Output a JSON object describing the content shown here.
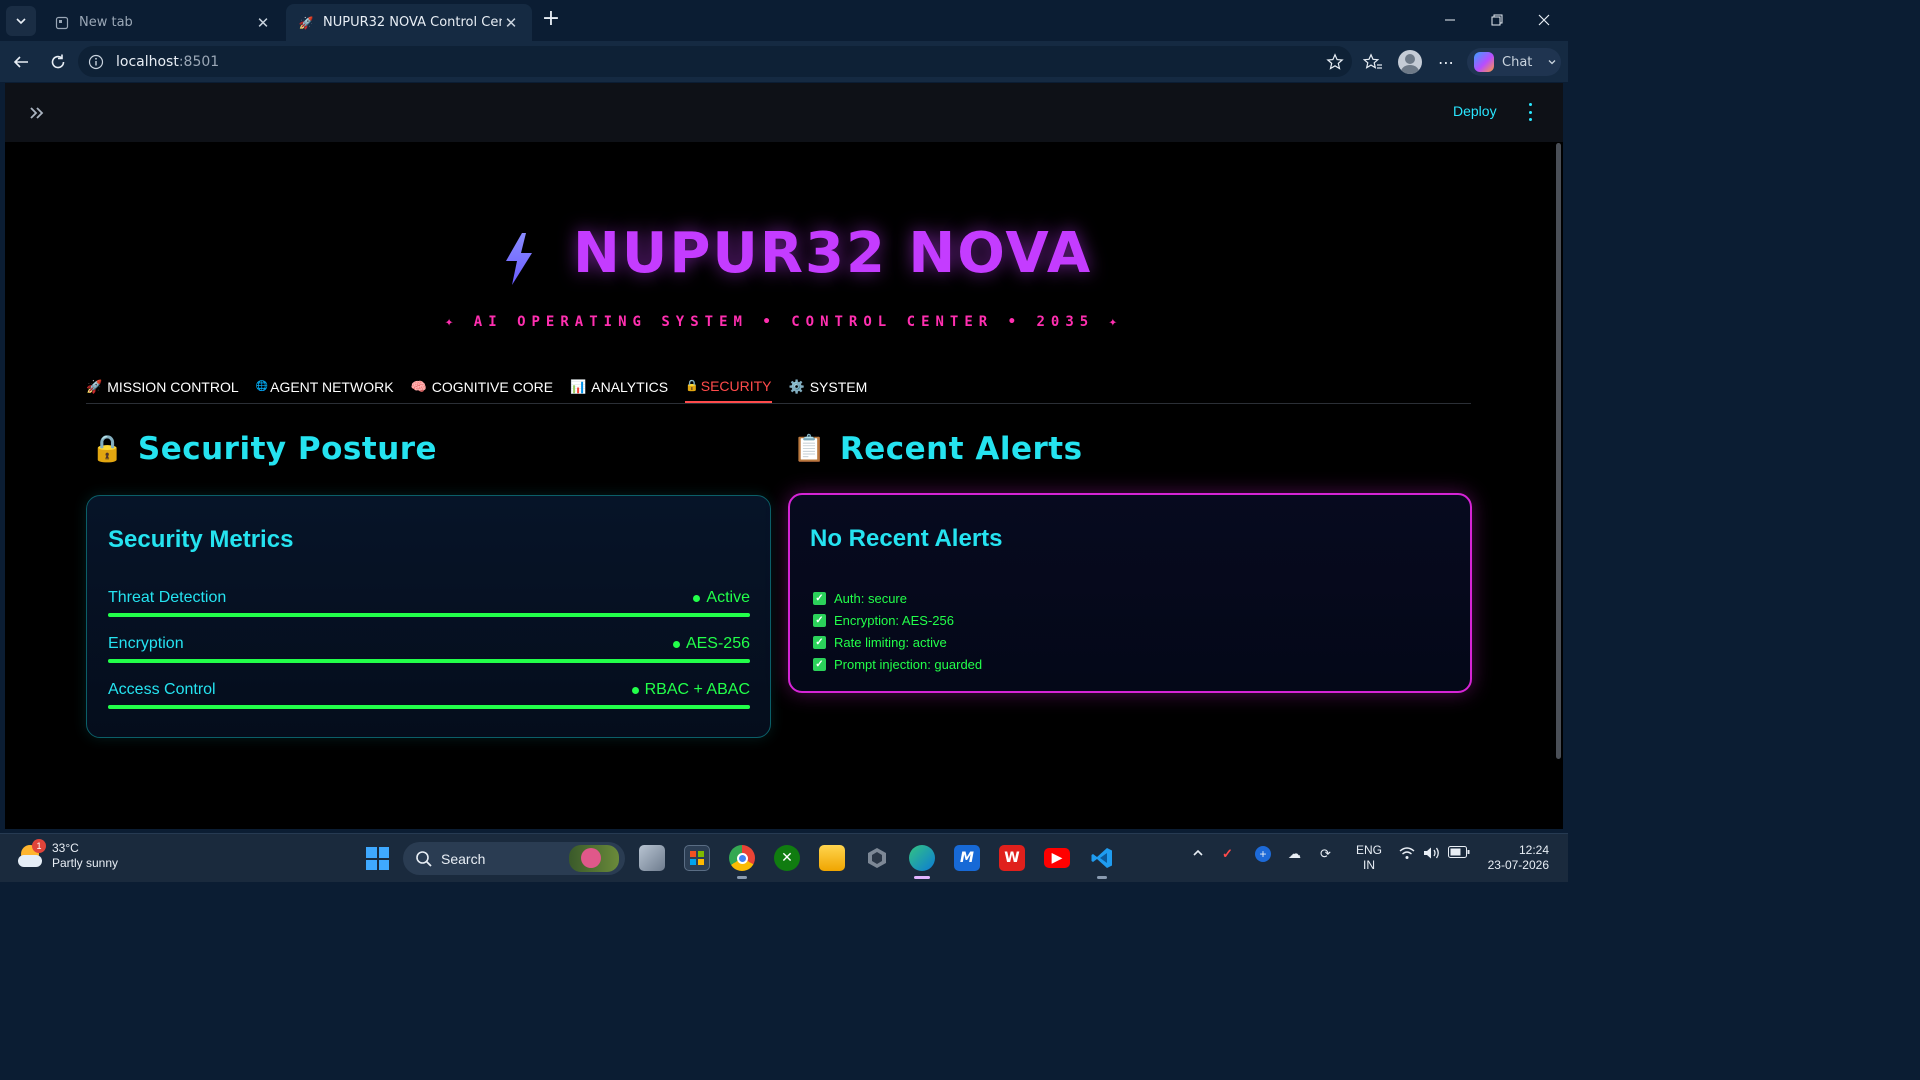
{
  "browser": {
    "tabs": [
      {
        "title": "New tab",
        "active": false
      },
      {
        "title": "NUPUR32 NOVA Control Center",
        "active": true
      }
    ],
    "url_host": "localhost",
    "url_port": ":8501",
    "chat_label": "Chat"
  },
  "app": {
    "deploy_label": "Deploy",
    "title": "NUPUR32 NOVA",
    "subtitle": "✦ AI OPERATING SYSTEM • CONTROL CENTER • 2035 ✦",
    "nav_tabs": [
      {
        "icon": "🚀",
        "label": "MISSION CONTROL",
        "active": false
      },
      {
        "icon": "🌐",
        "label": "AGENT NETWORK",
        "active": false
      },
      {
        "icon": "🧠",
        "label": "COGNITIVE CORE",
        "active": false
      },
      {
        "icon": "📊",
        "label": "ANALYTICS",
        "active": false
      },
      {
        "icon": "🔒",
        "label": "SECURITY",
        "active": true
      },
      {
        "icon": "⚙️",
        "label": "SYSTEM",
        "active": false
      }
    ],
    "security_posture": {
      "icon": "🔒",
      "heading": "Security Posture",
      "card_title": "Security Metrics",
      "metrics": [
        {
          "label": "Threat Detection",
          "value": "Active",
          "level": 1.0
        },
        {
          "label": "Encryption",
          "value": "AES-256",
          "level": 1.0
        },
        {
          "label": "Access Control",
          "value": "RBAC + ABAC",
          "level": 1.0
        }
      ]
    },
    "recent_alerts": {
      "icon": "📋",
      "heading": "Recent Alerts",
      "card_title": "No Recent Alerts",
      "items": [
        "Auth: secure",
        "Encryption: AES-256",
        "Rate limiting: active",
        "Prompt injection: guarded"
      ]
    },
    "colors": {
      "accent_cyan": "#25e3f0",
      "accent_magenta": "#c43cff",
      "status_green": "#22ff4a",
      "active_tab": "#ff4b4b"
    }
  },
  "taskbar": {
    "weather_temp": "33°C",
    "weather_desc": "Partly sunny",
    "weather_badge": "1",
    "search_placeholder": "Search",
    "lang_line1": "ENG",
    "lang_line2": "IN",
    "time": "12:24",
    "date": "23-07-2026"
  }
}
